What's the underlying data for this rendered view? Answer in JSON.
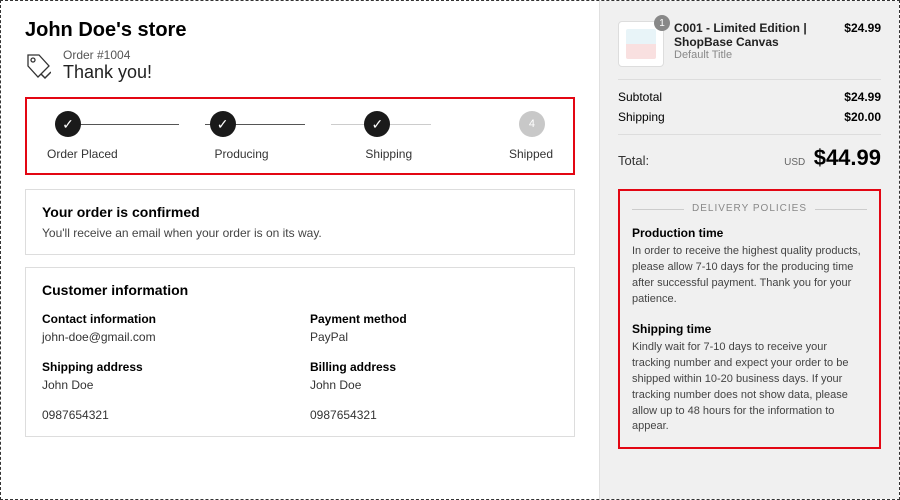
{
  "store": {
    "name": "John Doe's store"
  },
  "order": {
    "number": "Order #1004",
    "thankyou": "Thank you!"
  },
  "progress": {
    "steps": [
      {
        "label": "Order Placed",
        "done": true
      },
      {
        "label": "Producing",
        "done": true
      },
      {
        "label": "Shipping",
        "done": true
      },
      {
        "label": "Shipped",
        "done": false,
        "num": "4"
      }
    ]
  },
  "confirm": {
    "title": "Your order is confirmed",
    "text": "You'll receive an email when your order is on its way."
  },
  "customer": {
    "title": "Customer information",
    "contact": {
      "label": "Contact information",
      "value": "john-doe@gmail.com"
    },
    "payment": {
      "label": "Payment method",
      "value": "PayPal"
    },
    "shipping": {
      "label": "Shipping address",
      "name": "John Doe",
      "phone": "0987654321"
    },
    "billing": {
      "label": "Billing address",
      "name": "John Doe",
      "phone": "0987654321"
    }
  },
  "cart": {
    "item": {
      "qty": "1",
      "name": "C001 - Limited Edition | ShopBase Canvas",
      "variant": "Default Title",
      "price": "$24.99"
    },
    "subtotal": {
      "label": "Subtotal",
      "value": "$24.99"
    },
    "shipping": {
      "label": "Shipping",
      "value": "$20.00"
    },
    "total": {
      "label": "Total:",
      "currency": "USD",
      "value": "$44.99"
    }
  },
  "policies": {
    "header": "DELIVERY POLICIES",
    "production": {
      "title": "Production time",
      "text": "In order to receive the highest quality products, please allow 7-10 days for the producing time after successful payment. Thank you for your patience."
    },
    "shipping": {
      "title": "Shipping time",
      "text": "Kindly wait for 7-10 days to receive your tracking number and expect your order to be shipped within 10-20 business days. If your tracking number does not show data, please allow up to 48 hours for the information to appear."
    }
  }
}
